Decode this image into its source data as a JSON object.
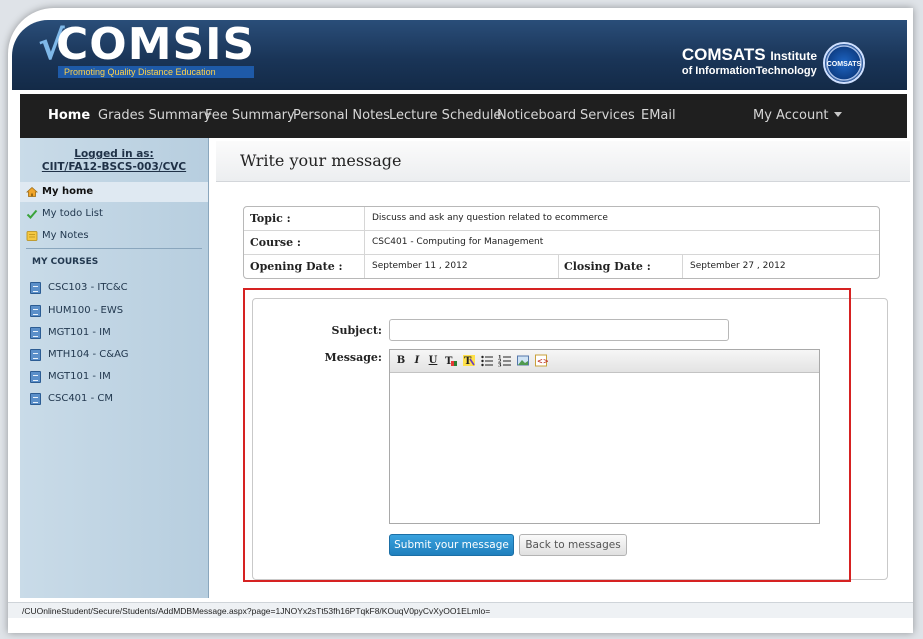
{
  "header": {
    "logo_text": "COMSIS",
    "logo_tagline": "Promoting Quality Distance Education",
    "institute_name": "COMSATS",
    "institute_suffix": "Institute",
    "institute_subtitle": "of InformationTechnology",
    "seal_text": "COMSATS"
  },
  "nav": {
    "items": [
      "Home",
      "Grades Summary",
      "Fee Summary",
      "Personal Notes",
      "Lecture Schedule",
      "Noticeboard",
      "Services",
      "EMail"
    ],
    "account_label": "My Account"
  },
  "sidebar": {
    "logged_in_label": "Logged in as:",
    "user_id": "CIIT/FA12-BSCS-003/CVC",
    "links": [
      "My home",
      "My todo List",
      "My Notes"
    ],
    "courses_heading": "MY COURSES",
    "courses": [
      "CSC103 - ITC&C",
      "HUM100 - EWS",
      "MGT101 - IM",
      "MTH104 - C&AG",
      "MGT101 - IM",
      "CSC401 - CM"
    ]
  },
  "page": {
    "title": "Write your message"
  },
  "info": {
    "topic_label": "Topic :",
    "topic_value": "Discuss and ask any question related to ecommerce",
    "course_label": "Course :",
    "course_value": "CSC401 - Computing for Management",
    "opening_label": "Opening Date :",
    "opening_value": "September 11 , 2012",
    "closing_label": "Closing Date :",
    "closing_value": "September 27 , 2012"
  },
  "form": {
    "subject_label": "Subject:",
    "subject_value": "",
    "message_label": "Message:",
    "toolbar_icons": [
      "bold-icon",
      "italic-icon",
      "underline-icon",
      "text-color-icon",
      "highlight-color-icon",
      "bullet-list-icon",
      "numbered-list-icon",
      "image-icon",
      "source-code-icon"
    ],
    "submit_label": "Submit your message",
    "back_label": "Back to messages"
  },
  "status": {
    "url": "/CUOnlineStudent/Secure/Students/AddMDBMessage.aspx?page=1JNOYx2sTt53fh16PTqkF8/KOuqV0pyCvXyOO1ELmlo="
  },
  "colors": {
    "highlight_border": "#d62222",
    "primary_button": "#1f7fbd",
    "nav_background": "#1f1f1f"
  }
}
